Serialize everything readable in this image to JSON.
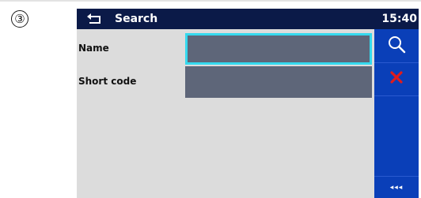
{
  "step_marker": "③",
  "header": {
    "title": "Search",
    "time": "15:40"
  },
  "form": {
    "fields": [
      {
        "label": "Name",
        "value": ""
      },
      {
        "label": "Short code",
        "value": ""
      }
    ]
  },
  "sidebar": {
    "search_icon": "magnifier-icon",
    "clear_icon": "red-x-icon",
    "back_label": "◂◂◂"
  },
  "colors": {
    "title_bar": "#0b1a48",
    "sidebar": "#0a3fb8",
    "form_bg": "#dcdcdc",
    "input_bg": "#5e6679",
    "focus_border": "#35d9ee",
    "clear_red": "#e11b1b"
  }
}
